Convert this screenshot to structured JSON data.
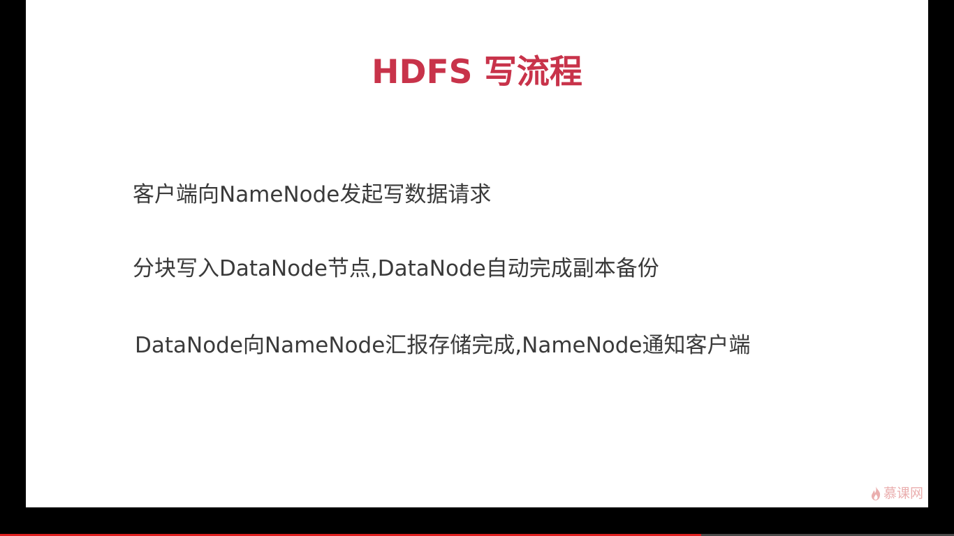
{
  "slide": {
    "title": "HDFS 写流程",
    "bullets": [
      "客户端向NameNode发起写数据请求",
      "分块写入DataNode节点,DataNode自动完成副本备份",
      "DataNode向NameNode汇报存储完成,NameNode通知客户端"
    ],
    "title_color": "#c8334a",
    "text_color": "#3a3a3a"
  },
  "watermark": {
    "icon": "flame-icon",
    "text": "慕课网",
    "color": "#e7a0a0"
  },
  "player": {
    "progress": 0.735,
    "progress_color": "#e02020"
  }
}
